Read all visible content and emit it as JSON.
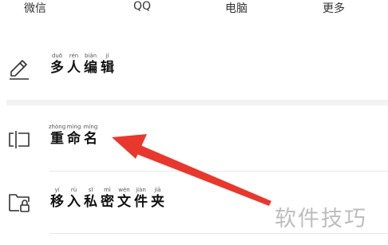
{
  "share_targets": {
    "wechat": "微信",
    "qq": "QQ",
    "pc": "电脑",
    "more": "更多"
  },
  "menu": {
    "collab_edit": {
      "icon": "pencil-icon",
      "chars": [
        {
          "py": "duō",
          "hz": "多"
        },
        {
          "py": "rén",
          "hz": "人"
        },
        {
          "py": "biān",
          "hz": "编"
        },
        {
          "py": "jí",
          "hz": "辑"
        }
      ]
    },
    "rename": {
      "icon": "rename-cursor-icon",
      "chars": [
        {
          "py": "zhòng",
          "hz": "重"
        },
        {
          "py": "mìng",
          "hz": "命"
        },
        {
          "py": "míng",
          "hz": "名"
        }
      ]
    },
    "move_private": {
      "icon": "locked-folder-icon",
      "chars": [
        {
          "py": "yí",
          "hz": "移"
        },
        {
          "py": "rù",
          "hz": "入"
        },
        {
          "py": "sī",
          "hz": "私"
        },
        {
          "py": "mì",
          "hz": "密"
        },
        {
          "py": "wén",
          "hz": "文"
        },
        {
          "py": "jiàn",
          "hz": "件"
        },
        {
          "py": "jiā",
          "hz": "夹"
        }
      ]
    }
  },
  "annotation": {
    "arrow_color": "#e8382d"
  },
  "watermark": "软件技巧"
}
